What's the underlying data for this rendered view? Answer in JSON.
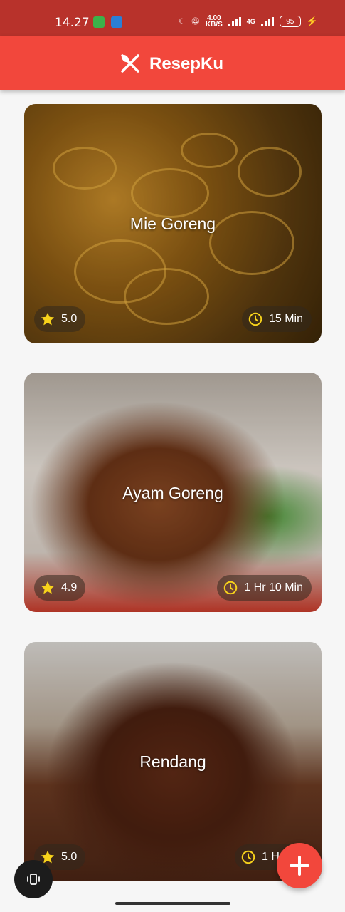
{
  "status_bar": {
    "time": "14.27",
    "network_speed": "4.00",
    "network_unit": "KB/S",
    "network_type": "4G",
    "battery": "95"
  },
  "app_bar": {
    "title": "ResepKu",
    "icon": "utensils-icon"
  },
  "recipes": [
    {
      "name": "Mie Goreng",
      "rating": "5.0",
      "duration": "15 Min"
    },
    {
      "name": "Ayam Goreng",
      "rating": "4.9",
      "duration": "1 Hr 10 Min"
    },
    {
      "name": "Rendang",
      "rating": "5.0",
      "duration": "1 Hr 5"
    }
  ],
  "fab": {
    "icon": "plus-icon"
  },
  "colors": {
    "status_bar": "#b8322b",
    "app_bar": "#f2473c",
    "star": "#f7d21b",
    "clock": "#f7d21b"
  }
}
